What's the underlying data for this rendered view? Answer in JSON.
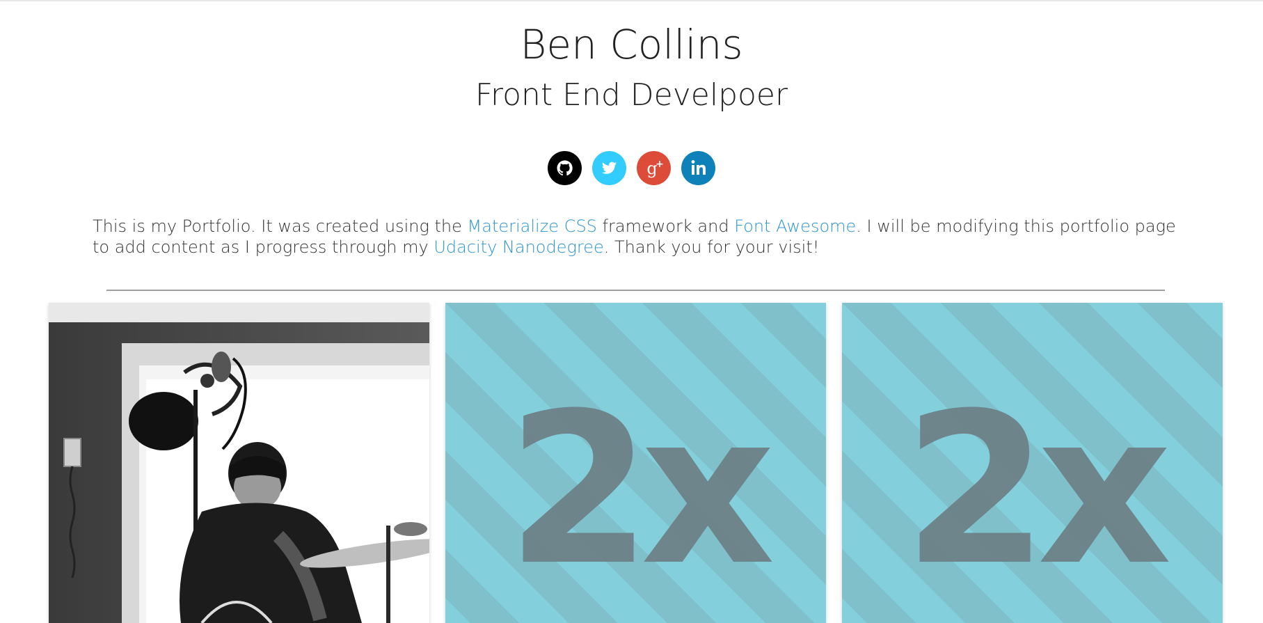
{
  "header": {
    "name": "Ben Collins",
    "role": "Front End Develpoer"
  },
  "social": {
    "links": [
      {
        "name": "github",
        "icon": "github-icon",
        "bg": "#000000"
      },
      {
        "name": "twitter",
        "icon": "twitter-icon",
        "bg": "#33ccff"
      },
      {
        "name": "google-plus",
        "icon": "google-plus-icon",
        "bg": "#dd4b39"
      },
      {
        "name": "linkedin",
        "icon": "linkedin-icon",
        "bg": "#0e82b8"
      }
    ]
  },
  "intro": {
    "part1": "This is my Portfolio. It was created using the ",
    "link1": "Materialize CSS",
    "part2": " framework and ",
    "link2": "Font Awesome",
    "part3": ". I will be modifying this portfolio page to add content as I progress through my ",
    "link3": "Udacity Nanodegree",
    "part4": ". Thank you for your visit!",
    "link_color": "#2b95d4"
  },
  "cards": [
    {
      "type": "photo",
      "description_icon": "drummer-photo"
    },
    {
      "type": "placeholder",
      "label": "2x",
      "bg": "#83d0dc",
      "stripe": "#76b8c4"
    },
    {
      "type": "placeholder",
      "label": "2x",
      "bg": "#83d0dc",
      "stripe": "#76b8c4"
    }
  ]
}
